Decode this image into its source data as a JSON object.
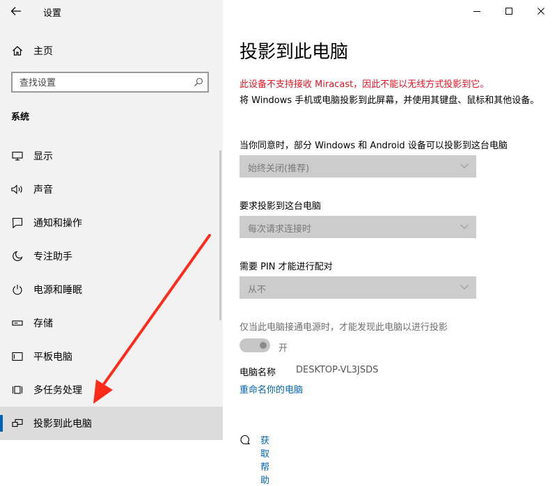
{
  "window": {
    "app_title": "设置",
    "minimize_icon": "minimize-icon",
    "maximize_icon": "maximize-icon",
    "close_icon": "close-icon"
  },
  "sidebar": {
    "home_label": "主页",
    "search_placeholder": "查找设置",
    "section_heading": "系统",
    "items": [
      {
        "label": "显示",
        "icon": "monitor-icon"
      },
      {
        "label": "声音",
        "icon": "speaker-icon"
      },
      {
        "label": "通知和操作",
        "icon": "notification-icon"
      },
      {
        "label": "专注助手",
        "icon": "moon-icon"
      },
      {
        "label": "电源和睡眠",
        "icon": "power-icon"
      },
      {
        "label": "存储",
        "icon": "storage-icon"
      },
      {
        "label": "平板电脑",
        "icon": "tablet-icon"
      },
      {
        "label": "多任务处理",
        "icon": "multitask-icon"
      },
      {
        "label": "投影到此电脑",
        "icon": "project-icon",
        "selected": true
      }
    ]
  },
  "main": {
    "title": "投影到此电脑",
    "warning": "此设备不支持接收 Miracast，因此不能以无线方式投影到它。",
    "description": "将 Windows 手机或电脑投影到此屏幕，并使用其键盘、鼠标和其他设备。",
    "setting1_label": "当你同意时，部分 Windows 和 Android 设备可以投影到这台电脑",
    "setting1_value": "始终关闭(推荐)",
    "setting2_label": "要求投影到这台电脑",
    "setting2_value": "每次请求连接时",
    "setting3_label": "需要 PIN 才能进行配对",
    "setting3_value": "从不",
    "power_label": "仅当此电脑接通电源时，才能发现此电脑以进行投影",
    "power_toggle_state": "开",
    "pc_name_label": "电脑名称",
    "pc_name_value": "DESKTOP-VL3JSDS",
    "rename_link": "重命名你的电脑",
    "help_link": "获取帮助"
  },
  "colors": {
    "accent": "#0063b1",
    "warning": "#e81123",
    "annotation_arrow": "#ff2a1a"
  }
}
